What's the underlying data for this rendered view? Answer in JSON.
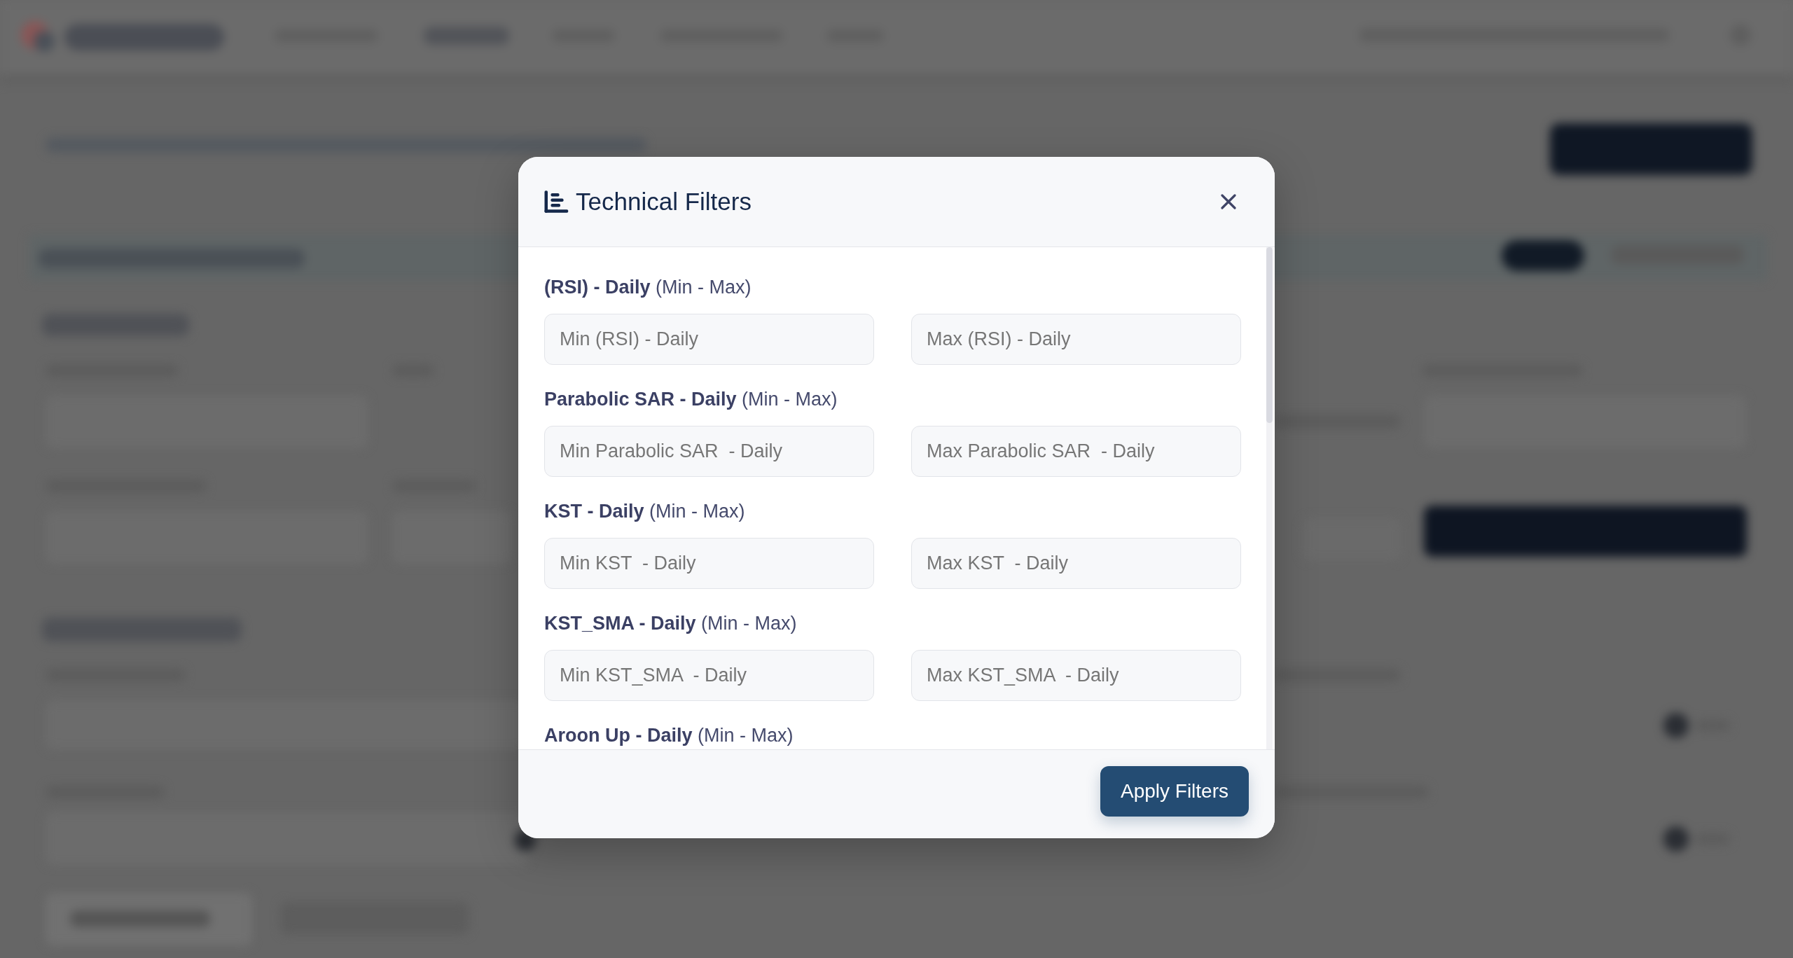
{
  "modal": {
    "title": "Technical Filters",
    "filters": [
      {
        "label": "**(RSI) - Daily** (Min - Max)",
        "fields": [
          {
            "placeholder": "Min (RSI) - Daily"
          },
          {
            "placeholder": "Max (RSI) - Daily"
          }
        ]
      },
      {
        "label": "**Parabolic SAR - Daily** (Min - Max)",
        "fields": [
          {
            "placeholder": "Min Parabolic SAR  - Daily"
          },
          {
            "placeholder": "Max Parabolic SAR  - Daily"
          }
        ]
      },
      {
        "label": "**KST - Daily** (Min - Max)",
        "fields": [
          {
            "placeholder": "Min KST  - Daily"
          },
          {
            "placeholder": "Max KST  - Daily"
          }
        ]
      },
      {
        "label": "**KST_SMA - Daily** (Min - Max)",
        "fields": [
          {
            "placeholder": "Min KST_SMA  - Daily"
          },
          {
            "placeholder": "Max KST_SMA  - Daily"
          }
        ]
      },
      {
        "label": "**Aroon Up - Daily** (Min - Max)"
      }
    ],
    "apply_button": "Apply Filters"
  }
}
